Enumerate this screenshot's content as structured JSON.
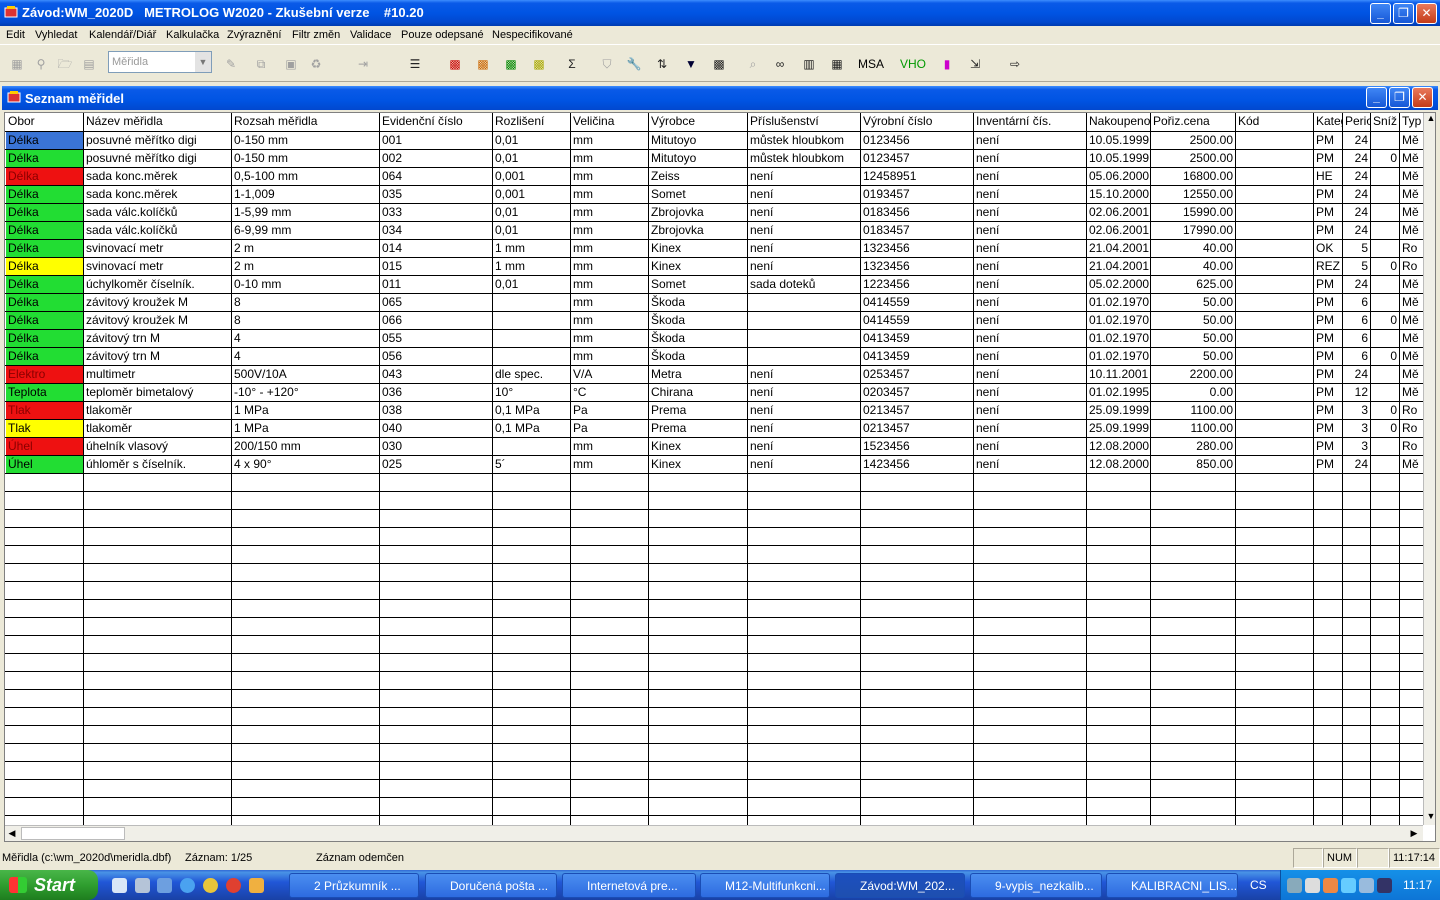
{
  "window": {
    "title": "Závod:WM_2020D   METROLOG W2020 - Zkušební verze    #10.20"
  },
  "menu": [
    "Edit",
    "Vyhledat",
    "Kalendář/Diář",
    "Kalkulačka",
    "Zvýraznění",
    "Filtr změn",
    "Validace",
    "Pouze odepsané",
    "Nespecifikované"
  ],
  "toolbar": {
    "combo_value": "Měřidla",
    "msa_label": "MSA",
    "vho_label": "VHO"
  },
  "child": {
    "title": "Seznam měřidel"
  },
  "grid": {
    "columns": [
      "Obor",
      "Název měřidla",
      "Rozsah měřidla",
      "Evidenční číslo",
      "Rozlišení",
      "Veličina",
      "Výrobce",
      "Příslušenství",
      "Výrobní číslo",
      "Inventární čís.",
      "Nakoupeno",
      "Pořiz.cena",
      "Kód",
      "Kategorie",
      "Perioda",
      "Sníž",
      "Typ"
    ],
    "rows": [
      {
        "obor": "Délka",
        "color": "#3a74d6",
        "nazev": "posuvné měřítko digi",
        "rozsah": "0-150 mm",
        "evid": "001",
        "rozl": "0,01",
        "vel": "mm",
        "vyr": "Mitutoyo",
        "prisl": "můstek hloubkom",
        "vyrc": "0123456",
        "inv": "není",
        "nak": "10.05.1999",
        "cena": "2500.00",
        "kod": "",
        "kat": "PM",
        "per": "24",
        "sniz": "",
        "typ": "Mě"
      },
      {
        "obor": "Délka",
        "color": "#22dd33",
        "nazev": "posuvné měřítko digi",
        "rozsah": "0-150 mm",
        "evid": "002",
        "rozl": "0,01",
        "vel": "mm",
        "vyr": "Mitutoyo",
        "prisl": "můstek hloubkom",
        "vyrc": "0123457",
        "inv": "není",
        "nak": "10.05.1999",
        "cena": "2500.00",
        "kod": "",
        "kat": "PM",
        "per": "24",
        "sniz": "0",
        "typ": "Mě"
      },
      {
        "obor": "Délka",
        "color": "#ee1111",
        "nazev": "sada konc.měrek",
        "rozsah": "0,5-100 mm",
        "evid": "064",
        "rozl": "0,001",
        "vel": "mm",
        "vyr": "Zeiss",
        "prisl": "není",
        "vyrc": "12458951",
        "inv": "není",
        "nak": "05.06.2000",
        "cena": "16800.00",
        "kod": "",
        "kat": "HE",
        "per": "24",
        "sniz": "",
        "typ": "Mě"
      },
      {
        "obor": "Délka",
        "color": "#22dd33",
        "nazev": "sada konc.měrek",
        "rozsah": "1-1,009",
        "evid": "035",
        "rozl": "0,001",
        "vel": "mm",
        "vyr": "Somet",
        "prisl": "není",
        "vyrc": "0193457",
        "inv": "není",
        "nak": "15.10.2000",
        "cena": "12550.00",
        "kod": "",
        "kat": "PM",
        "per": "24",
        "sniz": "",
        "typ": "Mě"
      },
      {
        "obor": "Délka",
        "color": "#22dd33",
        "nazev": "sada válc.kolíčků",
        "rozsah": "1-5,99 mm",
        "evid": "033",
        "rozl": "0,01",
        "vel": "mm",
        "vyr": "Zbrojovka",
        "prisl": "není",
        "vyrc": "0183456",
        "inv": "není",
        "nak": "02.06.2001",
        "cena": "15990.00",
        "kod": "",
        "kat": "PM",
        "per": "24",
        "sniz": "",
        "typ": "Mě"
      },
      {
        "obor": "Délka",
        "color": "#22dd33",
        "nazev": "sada válc.kolíčků",
        "rozsah": "6-9,99 mm",
        "evid": "034",
        "rozl": "0,01",
        "vel": "mm",
        "vyr": "Zbrojovka",
        "prisl": "není",
        "vyrc": "0183457",
        "inv": "není",
        "nak": "02.06.2001",
        "cena": "17990.00",
        "kod": "",
        "kat": "PM",
        "per": "24",
        "sniz": "",
        "typ": "Mě"
      },
      {
        "obor": "Délka",
        "color": "#22dd33",
        "nazev": "svinovací metr",
        "rozsah": "2 m",
        "evid": "014",
        "rozl": "1 mm",
        "vel": "mm",
        "vyr": "Kinex",
        "prisl": "není",
        "vyrc": "1323456",
        "inv": "není",
        "nak": "21.04.2001",
        "cena": "40.00",
        "kod": "",
        "kat": "OK",
        "per": "5",
        "sniz": "",
        "typ": "Ro"
      },
      {
        "obor": "Délka",
        "color": "#ffff00",
        "nazev": "svinovací metr",
        "rozsah": "2 m",
        "evid": "015",
        "rozl": "1 mm",
        "vel": "mm",
        "vyr": "Kinex",
        "prisl": "není",
        "vyrc": "1323456",
        "inv": "není",
        "nak": "21.04.2001",
        "cena": "40.00",
        "kod": "",
        "kat": "REZ",
        "per": "5",
        "sniz": "0",
        "typ": "Ro"
      },
      {
        "obor": "Délka",
        "color": "#22dd33",
        "nazev": "úchylkoměr číselník.",
        "rozsah": "0-10 mm",
        "evid": "011",
        "rozl": "0,01",
        "vel": "mm",
        "vyr": "Somet",
        "prisl": "sada doteků",
        "vyrc": "1223456",
        "inv": "není",
        "nak": "05.02.2000",
        "cena": "625.00",
        "kod": "",
        "kat": "PM",
        "per": "24",
        "sniz": "",
        "typ": "Mě"
      },
      {
        "obor": "Délka",
        "color": "#22dd33",
        "nazev": "závitový kroužek M",
        "rozsah": "8",
        "evid": "065",
        "rozl": "",
        "vel": "mm",
        "vyr": "Škoda",
        "prisl": "",
        "vyrc": "0414559",
        "inv": "není",
        "nak": "01.02.1970",
        "cena": "50.00",
        "kod": "",
        "kat": "PM",
        "per": "6",
        "sniz": "",
        "typ": "Mě"
      },
      {
        "obor": "Délka",
        "color": "#22dd33",
        "nazev": "závitový kroužek M",
        "rozsah": "8",
        "evid": "066",
        "rozl": "",
        "vel": "mm",
        "vyr": "Škoda",
        "prisl": "",
        "vyrc": "0414559",
        "inv": "není",
        "nak": "01.02.1970",
        "cena": "50.00",
        "kod": "",
        "kat": "PM",
        "per": "6",
        "sniz": "0",
        "typ": "Mě"
      },
      {
        "obor": "Délka",
        "color": "#22dd33",
        "nazev": "závitový trn M",
        "rozsah": "4",
        "evid": "055",
        "rozl": "",
        "vel": "mm",
        "vyr": "Škoda",
        "prisl": "",
        "vyrc": "0413459",
        "inv": "není",
        "nak": "01.02.1970",
        "cena": "50.00",
        "kod": "",
        "kat": "PM",
        "per": "6",
        "sniz": "",
        "typ": "Mě"
      },
      {
        "obor": "Délka",
        "color": "#22dd33",
        "nazev": "závitový trn M",
        "rozsah": "4",
        "evid": "056",
        "rozl": "",
        "vel": "mm",
        "vyr": "Škoda",
        "prisl": "",
        "vyrc": "0413459",
        "inv": "není",
        "nak": "01.02.1970",
        "cena": "50.00",
        "kod": "",
        "kat": "PM",
        "per": "6",
        "sniz": "0",
        "typ": "Mě"
      },
      {
        "obor": "Elektro",
        "color": "#ee1111",
        "nazev": "multimetr",
        "rozsah": "500V/10A",
        "evid": "043",
        "rozl": "dle spec.",
        "vel": "V/A",
        "vyr": "Metra",
        "prisl": "není",
        "vyrc": "0253457",
        "inv": "není",
        "nak": "10.11.2001",
        "cena": "2200.00",
        "kod": "",
        "kat": "PM",
        "per": "24",
        "sniz": "",
        "typ": "Mě"
      },
      {
        "obor": "Teplota",
        "color": "#22dd33",
        "nazev": "teploměr bimetalový",
        "rozsah": "-10° - +120°",
        "evid": "036",
        "rozl": "10°",
        "vel": "°C",
        "vyr": "Chirana",
        "prisl": "není",
        "vyrc": "0203457",
        "inv": "není",
        "nak": "01.02.1995",
        "cena": "0.00",
        "kod": "",
        "kat": "PM",
        "per": "12",
        "sniz": "",
        "typ": "Mě"
      },
      {
        "obor": "Tlak",
        "color": "#ee1111",
        "nazev": "tlakoměr",
        "rozsah": "1 MPa",
        "evid": "038",
        "rozl": "0,1 MPa",
        "vel": "Pa",
        "vyr": "Prema",
        "prisl": "není",
        "vyrc": "0213457",
        "inv": "není",
        "nak": "25.09.1999",
        "cena": "1100.00",
        "kod": "",
        "kat": "PM",
        "per": "3",
        "sniz": "0",
        "typ": "Ro"
      },
      {
        "obor": "Tlak",
        "color": "#ffff00",
        "nazev": "tlakoměr",
        "rozsah": "1 MPa",
        "evid": "040",
        "rozl": "0,1 MPa",
        "vel": "Pa",
        "vyr": "Prema",
        "prisl": "není",
        "vyrc": "0213457",
        "inv": "není",
        "nak": "25.09.1999",
        "cena": "1100.00",
        "kod": "",
        "kat": "PM",
        "per": "3",
        "sniz": "0",
        "typ": "Ro"
      },
      {
        "obor": "Úhel",
        "color": "#ee1111",
        "nazev": "úhelník vlasový",
        "rozsah": "200/150 mm",
        "evid": "030",
        "rozl": "",
        "vel": "mm",
        "vyr": "Kinex",
        "prisl": "není",
        "vyrc": "1523456",
        "inv": "není",
        "nak": "12.08.2000",
        "cena": "280.00",
        "kod": "",
        "kat": "PM",
        "per": "3",
        "sniz": "",
        "typ": "Ro"
      },
      {
        "obor": "Úhel",
        "color": "#22dd33",
        "nazev": "úhloměr s číselník.",
        "rozsah": "4 x 90°",
        "evid": "025",
        "rozl": "5´",
        "vel": "mm",
        "vyr": "Kinex",
        "prisl": "není",
        "vyrc": "1423456",
        "inv": "není",
        "nak": "12.08.2000",
        "cena": "850.00",
        "kod": "",
        "kat": "PM",
        "per": "24",
        "sniz": "",
        "typ": "Mě"
      }
    ]
  },
  "status": {
    "file": "Měřidla (c:\\wm_2020d\\meridla.dbf)",
    "record": "Záznam: 1/25",
    "lock": "Záznam odemčen",
    "num": "NUM",
    "time": "11:17:14"
  },
  "taskbar": {
    "start": "Start",
    "tasks": [
      "2 Průzkumník ...",
      "Doručená pošta ...",
      "Internetová pre...",
      "M12-Multifunkcni...",
      "Závod:WM_202...",
      "9-vypis_nezkalib...",
      "KALIBRACNI_LIS..."
    ],
    "lang": "CS",
    "clock": "11:17"
  }
}
